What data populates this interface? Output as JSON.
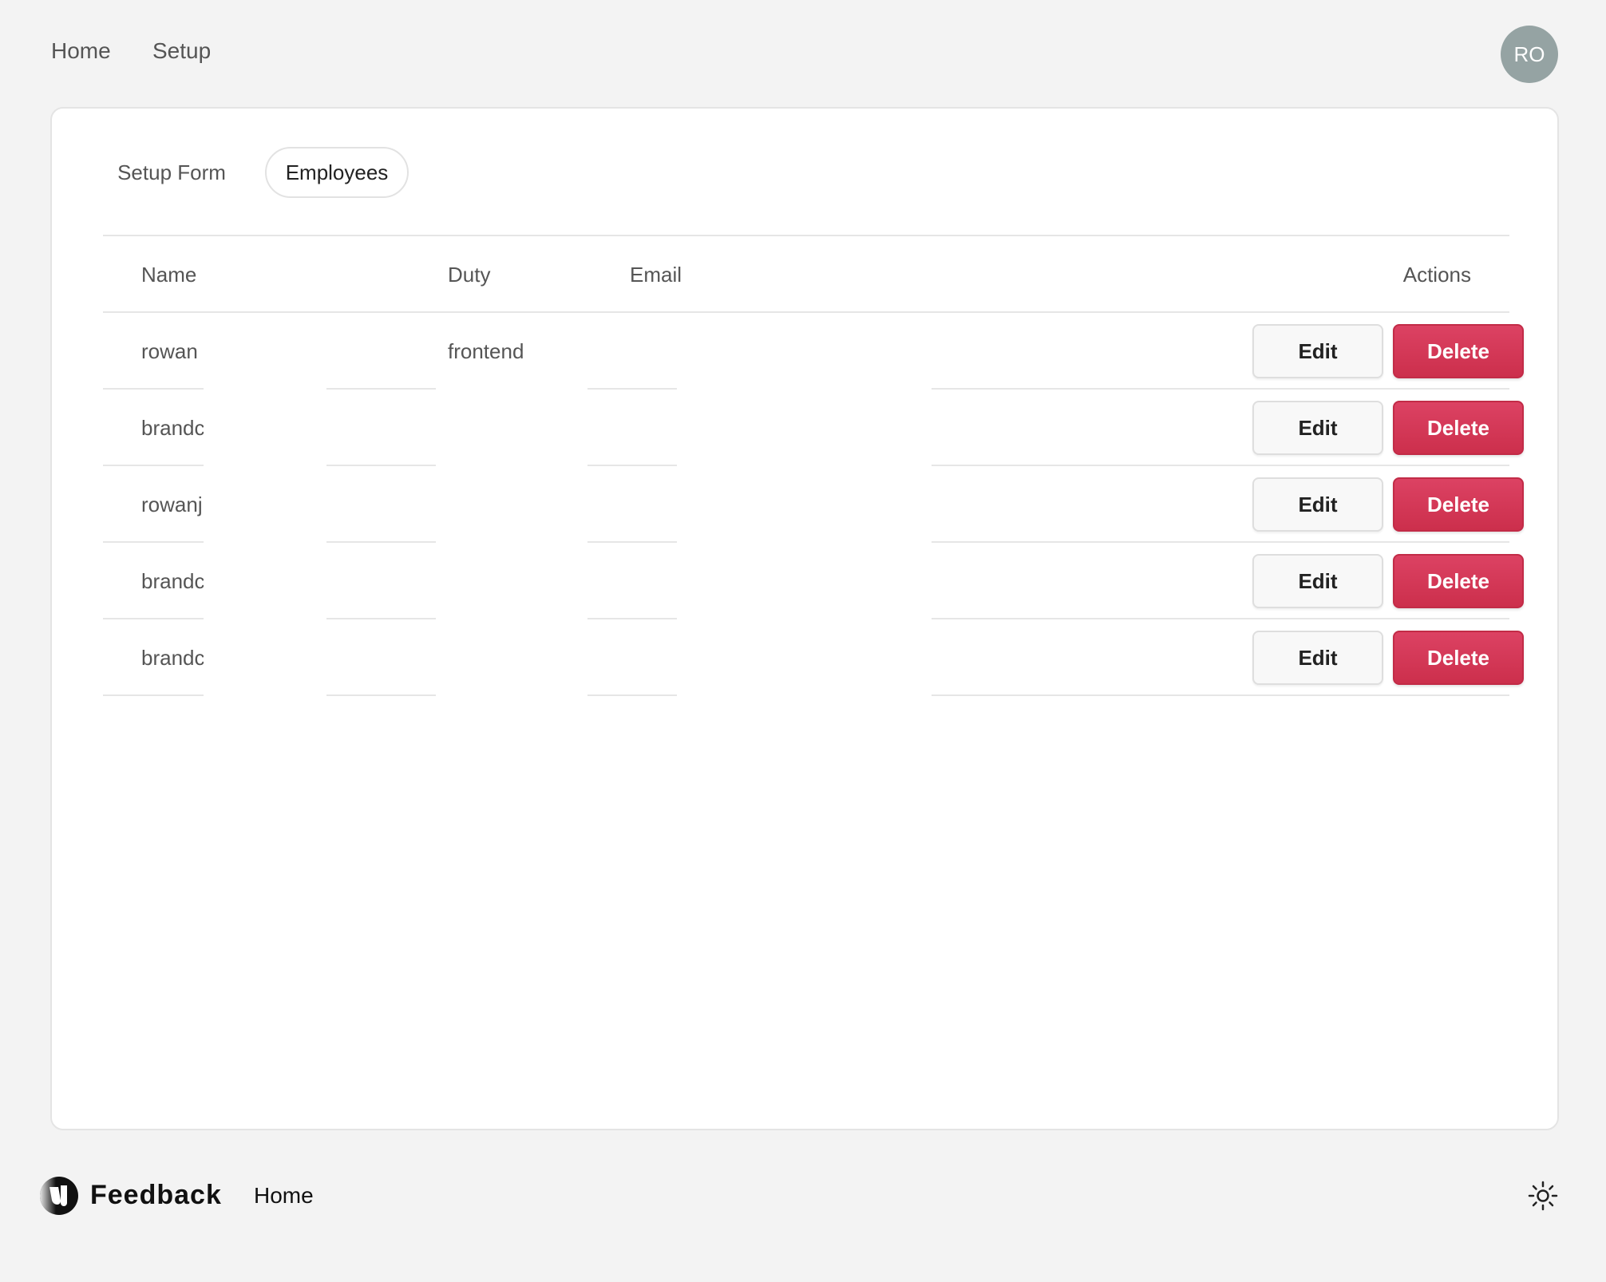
{
  "nav": {
    "home": "Home",
    "setup": "Setup"
  },
  "user": {
    "initials": "RO"
  },
  "tabs": {
    "setup_form": "Setup Form",
    "employees": "Employees"
  },
  "table": {
    "columns": {
      "name": "Name",
      "duty": "Duty",
      "email": "Email",
      "actions": "Actions"
    },
    "rows": [
      {
        "name": "rowan",
        "duty": "frontend",
        "email": ""
      },
      {
        "name": "brandc",
        "duty": "",
        "email": ""
      },
      {
        "name": "rowanj",
        "duty": "",
        "email": ""
      },
      {
        "name": "brandc",
        "duty": "",
        "email": ""
      },
      {
        "name": "brandc",
        "duty": "",
        "email": ""
      }
    ],
    "edit_label": "Edit",
    "delete_label": "Delete"
  },
  "footer": {
    "brand": "Feedback",
    "home": "Home",
    "theme_icon": "sun-icon"
  },
  "colors": {
    "delete": "#d63a58",
    "avatar": "#95a3a3"
  }
}
